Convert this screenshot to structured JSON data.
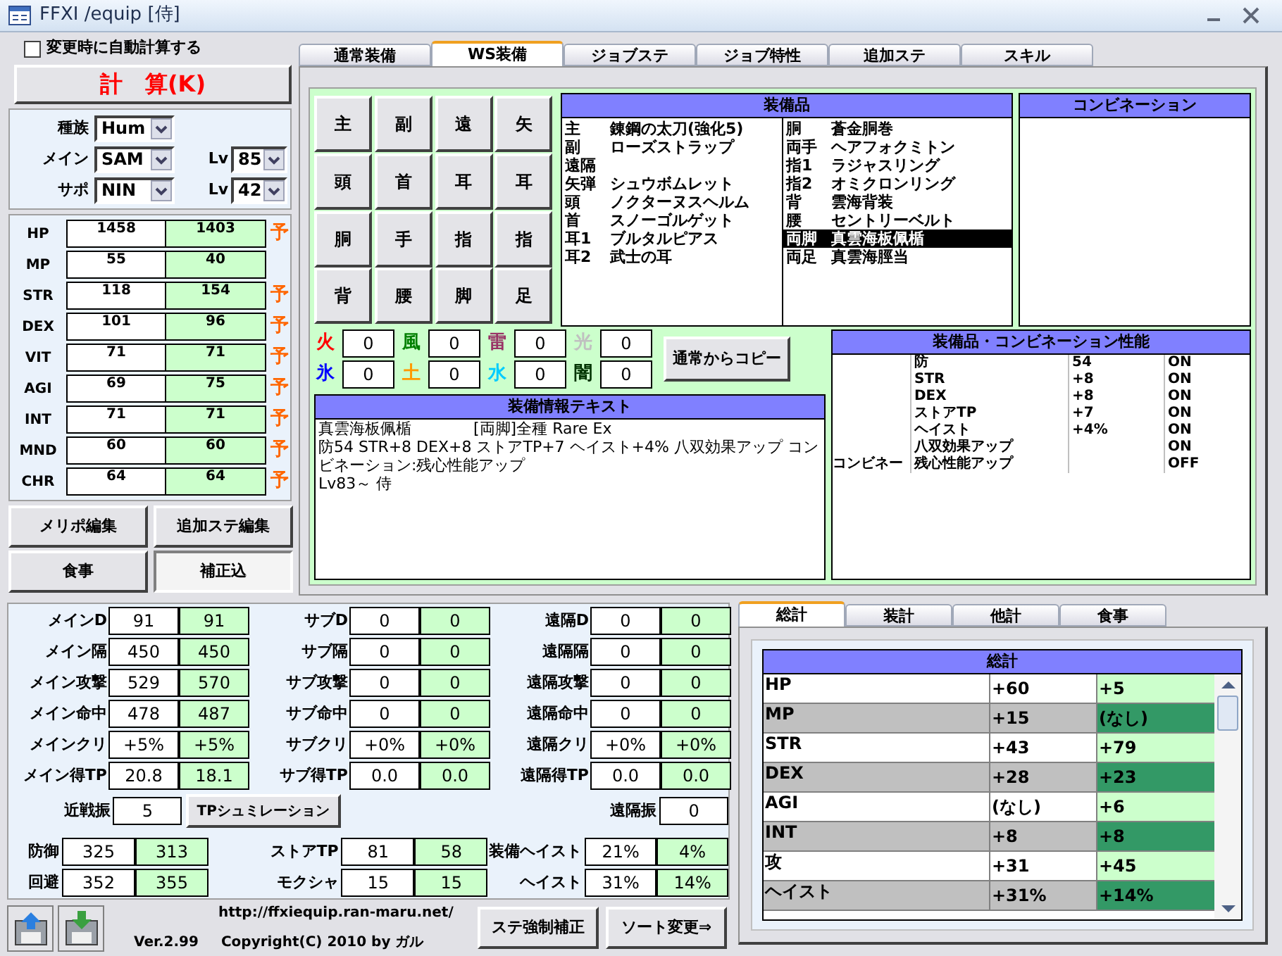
{
  "window": {
    "title": "FFXI /equip [侍]"
  },
  "auto_calc": {
    "label": "変更時に自動計算する",
    "checked": false
  },
  "calc_button": "計　算(K)",
  "selects": [
    {
      "label": "種族",
      "value": "Hum"
    },
    {
      "label": "メイン",
      "value": "SAM",
      "lv_label": "Lv",
      "lv": "85"
    },
    {
      "label": "サポ",
      "value": "NIN",
      "lv_label": "Lv",
      "lv": "42"
    }
  ],
  "stats": [
    {
      "name": "HP",
      "base": "1458",
      "total": "1403",
      "note": "予"
    },
    {
      "name": "MP",
      "base": "55",
      "total": "40"
    },
    {
      "name": "STR",
      "base": "118",
      "total": "154",
      "note": "予"
    },
    {
      "name": "DEX",
      "base": "101",
      "total": "96",
      "note": "予"
    },
    {
      "name": "VIT",
      "base": "71",
      "total": "71",
      "note": "予"
    },
    {
      "name": "AGI",
      "base": "69",
      "total": "75",
      "note": "予"
    },
    {
      "name": "INT",
      "base": "71",
      "total": "71",
      "note": "予"
    },
    {
      "name": "MND",
      "base": "60",
      "total": "60",
      "note": "予"
    },
    {
      "name": "CHR",
      "base": "64",
      "total": "64",
      "note": "予"
    }
  ],
  "side_buttons": [
    {
      "label": "メリポ編集",
      "pressed": false
    },
    {
      "label": "追加ステ編集",
      "pressed": false
    },
    {
      "label": "食事",
      "pressed": false
    },
    {
      "label": "補正込",
      "pressed": true
    }
  ],
  "tabs": [
    {
      "label": "通常装備",
      "selected": false
    },
    {
      "label": "WS装備",
      "selected": true
    },
    {
      "label": "ジョブステ",
      "selected": false
    },
    {
      "label": "ジョブ特性",
      "selected": false
    },
    {
      "label": "追加ステ",
      "selected": false
    },
    {
      "label": "スキル",
      "selected": false
    }
  ],
  "slot_buttons": [
    "主",
    "副",
    "遠",
    "矢",
    "頭",
    "首",
    "耳",
    "耳",
    "胴",
    "手",
    "指",
    "指",
    "背",
    "腰",
    "脚",
    "足"
  ],
  "equipment": {
    "title": "装備品",
    "left": [
      {
        "slot": "主",
        "item": "錬鋼の太刀(強化5)",
        "selected": false
      },
      {
        "slot": "副",
        "item": "ローズストラップ",
        "selected": false
      },
      {
        "slot": "遠隔",
        "selected": false
      },
      {
        "slot": "矢弾",
        "item": "シュウボムレット",
        "selected": false
      },
      {
        "slot": "頭",
        "item": "ノクターヌスヘルム",
        "selected": false
      },
      {
        "slot": "首",
        "item": "スノーゴルゲット",
        "selected": false
      },
      {
        "slot": "耳1",
        "item": "ブルタルピアス",
        "selected": false
      },
      {
        "slot": "耳2",
        "item": "武士の耳",
        "selected": false
      }
    ],
    "right": [
      {
        "slot": "胴",
        "item": "蒼金胴巻",
        "selected": false
      },
      {
        "slot": "両手",
        "item": "ヘアフォクミトン",
        "selected": false
      },
      {
        "slot": "指1",
        "item": "ラジャスリング",
        "selected": false
      },
      {
        "slot": "指2",
        "item": "オミクロンリング",
        "selected": false
      },
      {
        "slot": "背",
        "item": "雲海背装",
        "selected": false
      },
      {
        "slot": "腰",
        "item": "セントリーベルト",
        "selected": false
      },
      {
        "slot": "両脚",
        "item": "真雲海板佩楯",
        "selected": true
      },
      {
        "slot": "両足",
        "item": "真雲海脛当",
        "selected": false
      }
    ]
  },
  "combination": {
    "title": "コンビネーション"
  },
  "elements": [
    {
      "name": "火",
      "value": "0",
      "color": "#ff0000"
    },
    {
      "name": "風",
      "value": "0",
      "color": "#008000"
    },
    {
      "name": "雷",
      "value": "0",
      "color": "#993366"
    },
    {
      "name": "光",
      "value": "0",
      "color": "#c0c0c0"
    },
    {
      "name": "氷",
      "value": "0",
      "color": "#0000ff"
    },
    {
      "name": "土",
      "value": "0",
      "color": "#ff9900"
    },
    {
      "name": "水",
      "value": "0",
      "color": "#00ccff"
    },
    {
      "name": "闇",
      "value": "0",
      "color": "#003300"
    }
  ],
  "copy_button": "通常からコピー",
  "info": {
    "title": "装備情報テキスト",
    "lines": [
      "真雲海板佩楯　　　　[両脚]全種 Rare Ex",
      "防54 STR+8 DEX+8 ストアTP+7 ヘイスト+4% 八双効果アップ コンビネーション:残心性能アップ",
      "Lv83～ 侍"
    ]
  },
  "performance": {
    "title": "装備品・コンビネーション性能",
    "rows": [
      {
        "name": "防",
        "value": "54",
        "state": "ON"
      },
      {
        "name": "STR",
        "value": "+8",
        "state": "ON"
      },
      {
        "name": "DEX",
        "value": "+8",
        "state": "ON"
      },
      {
        "name": "ストアTP",
        "value": "+7",
        "state": "ON"
      },
      {
        "name": "ヘイスト",
        "value": "+4%",
        "state": "ON"
      },
      {
        "name": "八双効果アップ",
        "state": "ON"
      },
      {
        "group": "コンビネー",
        "name": "残心性能アップ",
        "state": "OFF"
      }
    ]
  },
  "battle_stats": [
    [
      {
        "label": "メインD",
        "base": "91",
        "total": "91"
      },
      {
        "label": "メイン隔",
        "base": "450",
        "total": "450"
      },
      {
        "label": "メイン攻撃",
        "base": "529",
        "total": "570"
      },
      {
        "label": "メイン命中",
        "base": "478",
        "total": "487"
      },
      {
        "label": "メインクリ",
        "base": "+5%",
        "total": "+5%"
      },
      {
        "label": "メイン得TP",
        "base": "20.8",
        "total": "18.1"
      }
    ],
    [
      {
        "label": "サブD",
        "base": "0",
        "total": "0"
      },
      {
        "label": "サブ隔",
        "base": "0",
        "total": "0"
      },
      {
        "label": "サブ攻撃",
        "base": "0",
        "total": "0"
      },
      {
        "label": "サブ命中",
        "base": "0",
        "total": "0"
      },
      {
        "label": "サブクリ",
        "base": "+0%",
        "total": "+0%"
      },
      {
        "label": "サブ得TP",
        "base": "0.0",
        "total": "0.0"
      }
    ],
    [
      {
        "label": "遠隔D",
        "base": "0",
        "total": "0"
      },
      {
        "label": "遠隔隔",
        "base": "0",
        "total": "0"
      },
      {
        "label": "遠隔攻撃",
        "base": "0",
        "total": "0"
      },
      {
        "label": "遠隔命中",
        "base": "0",
        "total": "0"
      },
      {
        "label": "遠隔クリ",
        "base": "+0%",
        "total": "+0%"
      },
      {
        "label": "遠隔得TP",
        "base": "0.0",
        "total": "0.0"
      }
    ]
  ],
  "melee_hits": {
    "label": "近戦振",
    "value": "5"
  },
  "tp_button": "TPシュミレーション",
  "ranged_hits": {
    "label": "遠隔振",
    "value": "0"
  },
  "defense_stats": [
    {
      "label": "防御",
      "base": "325",
      "total": "313"
    },
    {
      "label": "ストアTP",
      "base": "81",
      "total": "58"
    },
    {
      "label": "装備ヘイスト",
      "base": "21%",
      "total": "4%"
    },
    {
      "label": "回避",
      "base": "352",
      "total": "355"
    },
    {
      "label": "モクシャ",
      "base": "15",
      "total": "15"
    },
    {
      "label": "ヘイスト",
      "base": "31%",
      "total": "14%"
    }
  ],
  "footer": {
    "url": "http://ffxiequip.ran-maru.net/",
    "version": "Ver.2.99",
    "copyright": "Copyright(C) 2010 by ガル",
    "buttons": [
      "ステ強制補正",
      "ソート変更⇒"
    ]
  },
  "summary_tabs": [
    {
      "label": "総計",
      "selected": true
    },
    {
      "label": "装計",
      "selected": false
    },
    {
      "label": "他計",
      "selected": false
    },
    {
      "label": "食事",
      "selected": false
    }
  ],
  "summary": {
    "title": "総計",
    "rows": [
      {
        "name": "HP",
        "equip": "+60",
        "other": "+5"
      },
      {
        "name": "MP",
        "equip": "+15",
        "other": "(なし)"
      },
      {
        "name": "STR",
        "equip": "+43",
        "other": "+79"
      },
      {
        "name": "DEX",
        "equip": "+28",
        "other": "+23"
      },
      {
        "name": "AGI",
        "equip": "(なし)",
        "other": "+6"
      },
      {
        "name": "INT",
        "equip": "+8",
        "other": "+8"
      },
      {
        "name": "攻",
        "equip": "+31",
        "other": "+45"
      },
      {
        "name": "ヘイスト",
        "equip": "+31%",
        "other": "+14%"
      }
    ]
  }
}
